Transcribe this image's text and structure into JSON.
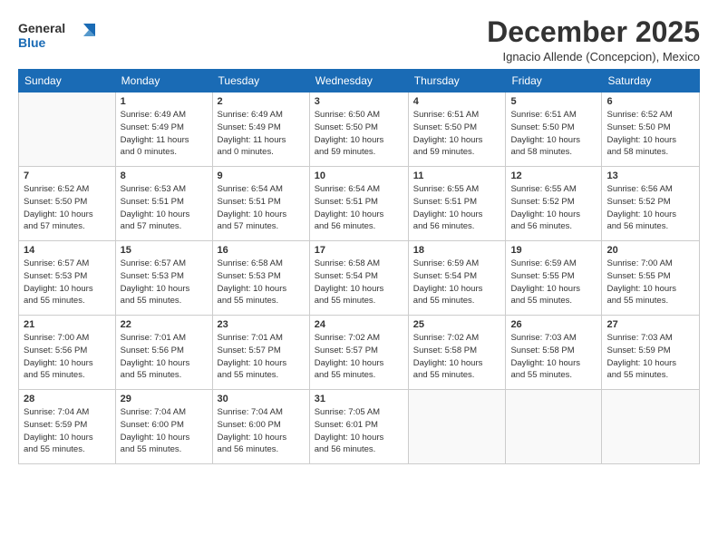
{
  "header": {
    "logo_line1": "General",
    "logo_line2": "Blue",
    "month_title": "December 2025",
    "location": "Ignacio Allende (Concepcion), Mexico"
  },
  "days_of_week": [
    "Sunday",
    "Monday",
    "Tuesday",
    "Wednesday",
    "Thursday",
    "Friday",
    "Saturday"
  ],
  "weeks": [
    [
      {
        "day": "",
        "info": ""
      },
      {
        "day": "1",
        "info": "Sunrise: 6:49 AM\nSunset: 5:49 PM\nDaylight: 11 hours\nand 0 minutes."
      },
      {
        "day": "2",
        "info": "Sunrise: 6:49 AM\nSunset: 5:49 PM\nDaylight: 11 hours\nand 0 minutes."
      },
      {
        "day": "3",
        "info": "Sunrise: 6:50 AM\nSunset: 5:50 PM\nDaylight: 10 hours\nand 59 minutes."
      },
      {
        "day": "4",
        "info": "Sunrise: 6:51 AM\nSunset: 5:50 PM\nDaylight: 10 hours\nand 59 minutes."
      },
      {
        "day": "5",
        "info": "Sunrise: 6:51 AM\nSunset: 5:50 PM\nDaylight: 10 hours\nand 58 minutes."
      },
      {
        "day": "6",
        "info": "Sunrise: 6:52 AM\nSunset: 5:50 PM\nDaylight: 10 hours\nand 58 minutes."
      }
    ],
    [
      {
        "day": "7",
        "info": "Sunrise: 6:52 AM\nSunset: 5:50 PM\nDaylight: 10 hours\nand 57 minutes."
      },
      {
        "day": "8",
        "info": "Sunrise: 6:53 AM\nSunset: 5:51 PM\nDaylight: 10 hours\nand 57 minutes."
      },
      {
        "day": "9",
        "info": "Sunrise: 6:54 AM\nSunset: 5:51 PM\nDaylight: 10 hours\nand 57 minutes."
      },
      {
        "day": "10",
        "info": "Sunrise: 6:54 AM\nSunset: 5:51 PM\nDaylight: 10 hours\nand 56 minutes."
      },
      {
        "day": "11",
        "info": "Sunrise: 6:55 AM\nSunset: 5:51 PM\nDaylight: 10 hours\nand 56 minutes."
      },
      {
        "day": "12",
        "info": "Sunrise: 6:55 AM\nSunset: 5:52 PM\nDaylight: 10 hours\nand 56 minutes."
      },
      {
        "day": "13",
        "info": "Sunrise: 6:56 AM\nSunset: 5:52 PM\nDaylight: 10 hours\nand 56 minutes."
      }
    ],
    [
      {
        "day": "14",
        "info": "Sunrise: 6:57 AM\nSunset: 5:53 PM\nDaylight: 10 hours\nand 55 minutes."
      },
      {
        "day": "15",
        "info": "Sunrise: 6:57 AM\nSunset: 5:53 PM\nDaylight: 10 hours\nand 55 minutes."
      },
      {
        "day": "16",
        "info": "Sunrise: 6:58 AM\nSunset: 5:53 PM\nDaylight: 10 hours\nand 55 minutes."
      },
      {
        "day": "17",
        "info": "Sunrise: 6:58 AM\nSunset: 5:54 PM\nDaylight: 10 hours\nand 55 minutes."
      },
      {
        "day": "18",
        "info": "Sunrise: 6:59 AM\nSunset: 5:54 PM\nDaylight: 10 hours\nand 55 minutes."
      },
      {
        "day": "19",
        "info": "Sunrise: 6:59 AM\nSunset: 5:55 PM\nDaylight: 10 hours\nand 55 minutes."
      },
      {
        "day": "20",
        "info": "Sunrise: 7:00 AM\nSunset: 5:55 PM\nDaylight: 10 hours\nand 55 minutes."
      }
    ],
    [
      {
        "day": "21",
        "info": "Sunrise: 7:00 AM\nSunset: 5:56 PM\nDaylight: 10 hours\nand 55 minutes."
      },
      {
        "day": "22",
        "info": "Sunrise: 7:01 AM\nSunset: 5:56 PM\nDaylight: 10 hours\nand 55 minutes."
      },
      {
        "day": "23",
        "info": "Sunrise: 7:01 AM\nSunset: 5:57 PM\nDaylight: 10 hours\nand 55 minutes."
      },
      {
        "day": "24",
        "info": "Sunrise: 7:02 AM\nSunset: 5:57 PM\nDaylight: 10 hours\nand 55 minutes."
      },
      {
        "day": "25",
        "info": "Sunrise: 7:02 AM\nSunset: 5:58 PM\nDaylight: 10 hours\nand 55 minutes."
      },
      {
        "day": "26",
        "info": "Sunrise: 7:03 AM\nSunset: 5:58 PM\nDaylight: 10 hours\nand 55 minutes."
      },
      {
        "day": "27",
        "info": "Sunrise: 7:03 AM\nSunset: 5:59 PM\nDaylight: 10 hours\nand 55 minutes."
      }
    ],
    [
      {
        "day": "28",
        "info": "Sunrise: 7:04 AM\nSunset: 5:59 PM\nDaylight: 10 hours\nand 55 minutes."
      },
      {
        "day": "29",
        "info": "Sunrise: 7:04 AM\nSunset: 6:00 PM\nDaylight: 10 hours\nand 55 minutes."
      },
      {
        "day": "30",
        "info": "Sunrise: 7:04 AM\nSunset: 6:00 PM\nDaylight: 10 hours\nand 56 minutes."
      },
      {
        "day": "31",
        "info": "Sunrise: 7:05 AM\nSunset: 6:01 PM\nDaylight: 10 hours\nand 56 minutes."
      },
      {
        "day": "",
        "info": ""
      },
      {
        "day": "",
        "info": ""
      },
      {
        "day": "",
        "info": ""
      }
    ]
  ]
}
